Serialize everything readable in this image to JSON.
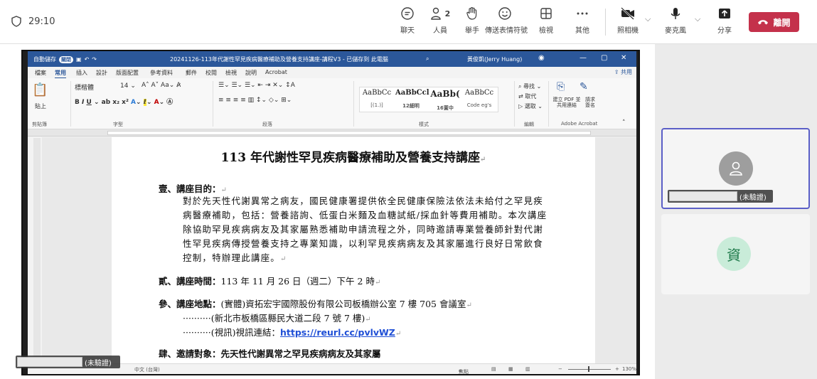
{
  "meeting": {
    "timer": "29:10",
    "toolbar": {
      "chat": "聊天",
      "people": "人員",
      "people_count": "2",
      "raise_hand": "舉手",
      "reactions": "傳送表情符號",
      "view": "檢視",
      "more": "其他",
      "camera": "照相機",
      "mic": "麥克風",
      "share": "分享",
      "leave": "離開"
    }
  },
  "word": {
    "autosave": "自動儲存",
    "autosave_state": "關閉",
    "doc_title": "20241126-113年代謝性罕見疾病醫療補助及營養支持講座-講程V3 - 已儲存到 此電腦",
    "search_hint": "搜尋",
    "user": "黃俊凱(Jerry Huang)",
    "menu": [
      "檔案",
      "常用",
      "插入",
      "設計",
      "版面配置",
      "參考資料",
      "郵件",
      "校閱",
      "檢視",
      "說明",
      "Acrobat"
    ],
    "share": "共用",
    "ribbon": {
      "paste": "貼上",
      "clipboard": "剪貼簿",
      "font_name": "標楷體",
      "font_size": "14",
      "font_group": "字型",
      "paragraph_group": "段落",
      "styles_group": "樣式",
      "editing_group": "編輯",
      "adobe_group": "Adobe Acrobat",
      "find": "尋找",
      "replace": "取代",
      "select": "選取",
      "create_pdf": "建立 PDF 並共用連結",
      "request_sign": "請求 簽名",
      "styles": [
        {
          "sample": "AaBbCc",
          "caption": "[(1.)]"
        },
        {
          "sample": "AaBbCcl",
          "caption": "12細明"
        },
        {
          "sample": "AaBb(",
          "caption": "16置中"
        },
        {
          "sample": "AaBbCc",
          "caption": "Code eg's"
        }
      ]
    },
    "document": {
      "title": "113 年代謝性罕見疾病醫療補助及營養支持講座",
      "sec1_head": "壹、講座目的：",
      "sec1_body": "對於先天性代謝異常之病友，國民健康署提供依全民健康保險法依法未給付之罕見疾病醫療補助，包括：營養諮詢、低蛋白米麵及血糖試紙/採血針等費用補助。本次講座除協助罕見疾病病友及其家屬熟悉補助申請流程之外，同時邀請專業營養師針對代謝性罕見疾病傳授營養支持之專業知識，以利罕見疾病病友及其家屬進行良好日常飲食控制，特辦理此講座。",
      "sec2_head": "貳、講座時間：",
      "sec2_body": "113 年 11 月 26 日（週二）下午 2 時",
      "sec3_head": "參、講座地點：",
      "sec3_body": "(實體)資拓宏宇國際股份有限公司板橋辦公室 7 樓 705 會議室",
      "sec3_line2": "··········(新北市板橋區縣民大道二段 7 號 7 樓)",
      "sec3_line3": "··········(視訊)視訊連結：",
      "sec3_link": "https://reurl.cc/pvlvWZ",
      "sec4_partial": "肆、邀請對象：先天性代謝異常之罕見疾病病友及其家屬"
    },
    "status": {
      "lang": "中文 (台灣)",
      "focus": "焦點",
      "zoom": "130%"
    }
  },
  "participants": {
    "presenter_tag": "(未驗證)",
    "tile1_tag": "(未驗證)",
    "tile2_initial": "資"
  }
}
